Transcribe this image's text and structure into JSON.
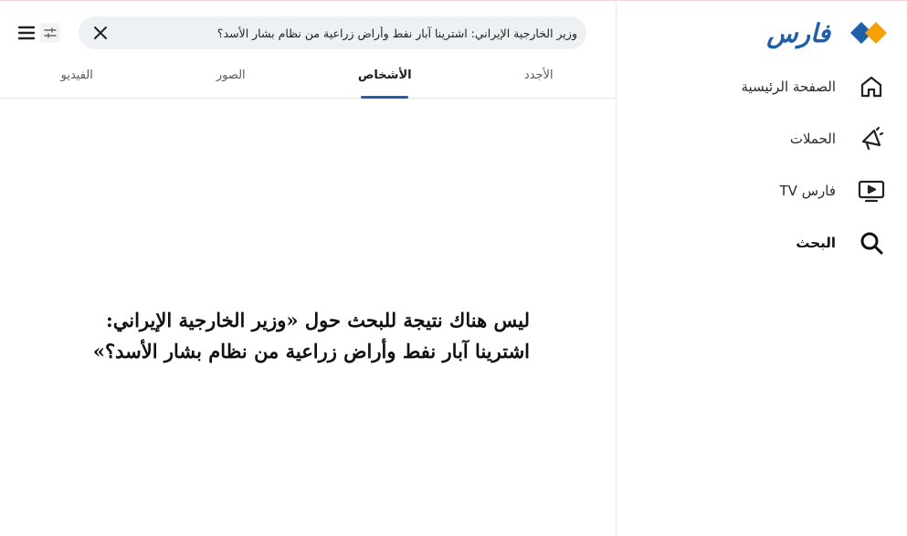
{
  "app": {
    "logo_text": "فارس",
    "colors": {
      "brand_blue": "#1f5ea8",
      "brand_orange": "#f5a20a",
      "active_tab_underline": "#1f5ea8"
    }
  },
  "sidebar": {
    "items": [
      {
        "label": "الصفحة الرئيسية",
        "icon": "home-icon",
        "active": false
      },
      {
        "label": "الحملات",
        "icon": "megaphone-icon",
        "active": false
      },
      {
        "label": "فارس TV",
        "icon": "tv-play-icon",
        "active": false
      },
      {
        "label": "البحث",
        "icon": "search-icon",
        "active": true
      }
    ]
  },
  "search": {
    "value": "وزير الخارجية الإيراني: اشترينا آبار نفط وأراض زراعية من نظام بشار الأسد؟",
    "clear_icon": "close-icon",
    "filter_icon": "filter-sliders-icon",
    "menu_icon": "menu-icon"
  },
  "tabs": [
    {
      "label": "الأجدد",
      "active": false
    },
    {
      "label": "الأشخاص",
      "active": true
    },
    {
      "label": "الصور",
      "active": false
    },
    {
      "label": "الفيديو",
      "active": false
    }
  ],
  "results": {
    "empty_message": "ليس هناك نتيجة للبحث حول «وزير الخارجية الإيراني: اشترينا آبار نفط وأراض زراعية من نظام بشار الأسد؟»"
  }
}
